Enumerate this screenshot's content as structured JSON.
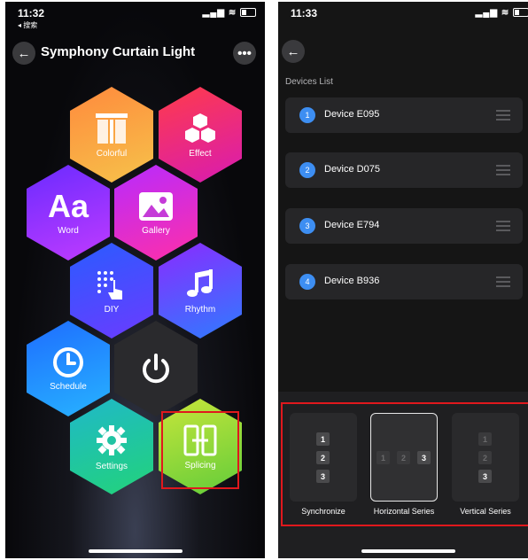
{
  "left": {
    "status": {
      "time": "11:32",
      "sub": "◂ 搜索"
    },
    "title": "Symphony Curtain Light",
    "tiles": [
      {
        "label": "Colorful",
        "icon": "curtain-icon"
      },
      {
        "label": "Effect",
        "icon": "hexagons-icon"
      },
      {
        "label": "Word",
        "icon": "text-aa-icon",
        "glyph": "Aa"
      },
      {
        "label": "Gallery",
        "icon": "image-icon"
      },
      {
        "label": "DIY",
        "icon": "touch-grid-icon"
      },
      {
        "label": "Rhythm",
        "icon": "music-note-icon"
      },
      {
        "label": "Schedule",
        "icon": "clock-icon"
      },
      {
        "label": "",
        "icon": "power-icon"
      },
      {
        "label": "Settings",
        "icon": "gear-icon"
      },
      {
        "label": "Splicing",
        "icon": "splicing-icon"
      }
    ]
  },
  "right": {
    "status": {
      "time": "11:33"
    },
    "section_title": "Devices List",
    "devices": [
      {
        "num": "1",
        "name": "Device E095"
      },
      {
        "num": "2",
        "name": "Device D075"
      },
      {
        "num": "3",
        "name": "Device E794"
      },
      {
        "num": "4",
        "name": "Device B936"
      }
    ],
    "modes": [
      {
        "label": "Synchronize",
        "selected": false,
        "boxes": [
          "1",
          "2",
          "3"
        ]
      },
      {
        "label": "Horizontal Series",
        "selected": true,
        "boxes": [
          "1",
          "2",
          "3"
        ]
      },
      {
        "label": "Vertical Series",
        "selected": false,
        "boxes": [
          "1",
          "2",
          "3"
        ]
      }
    ]
  },
  "colors": {
    "accent_blue": "#3d8ef2",
    "highlight_red": "#e0181d"
  }
}
